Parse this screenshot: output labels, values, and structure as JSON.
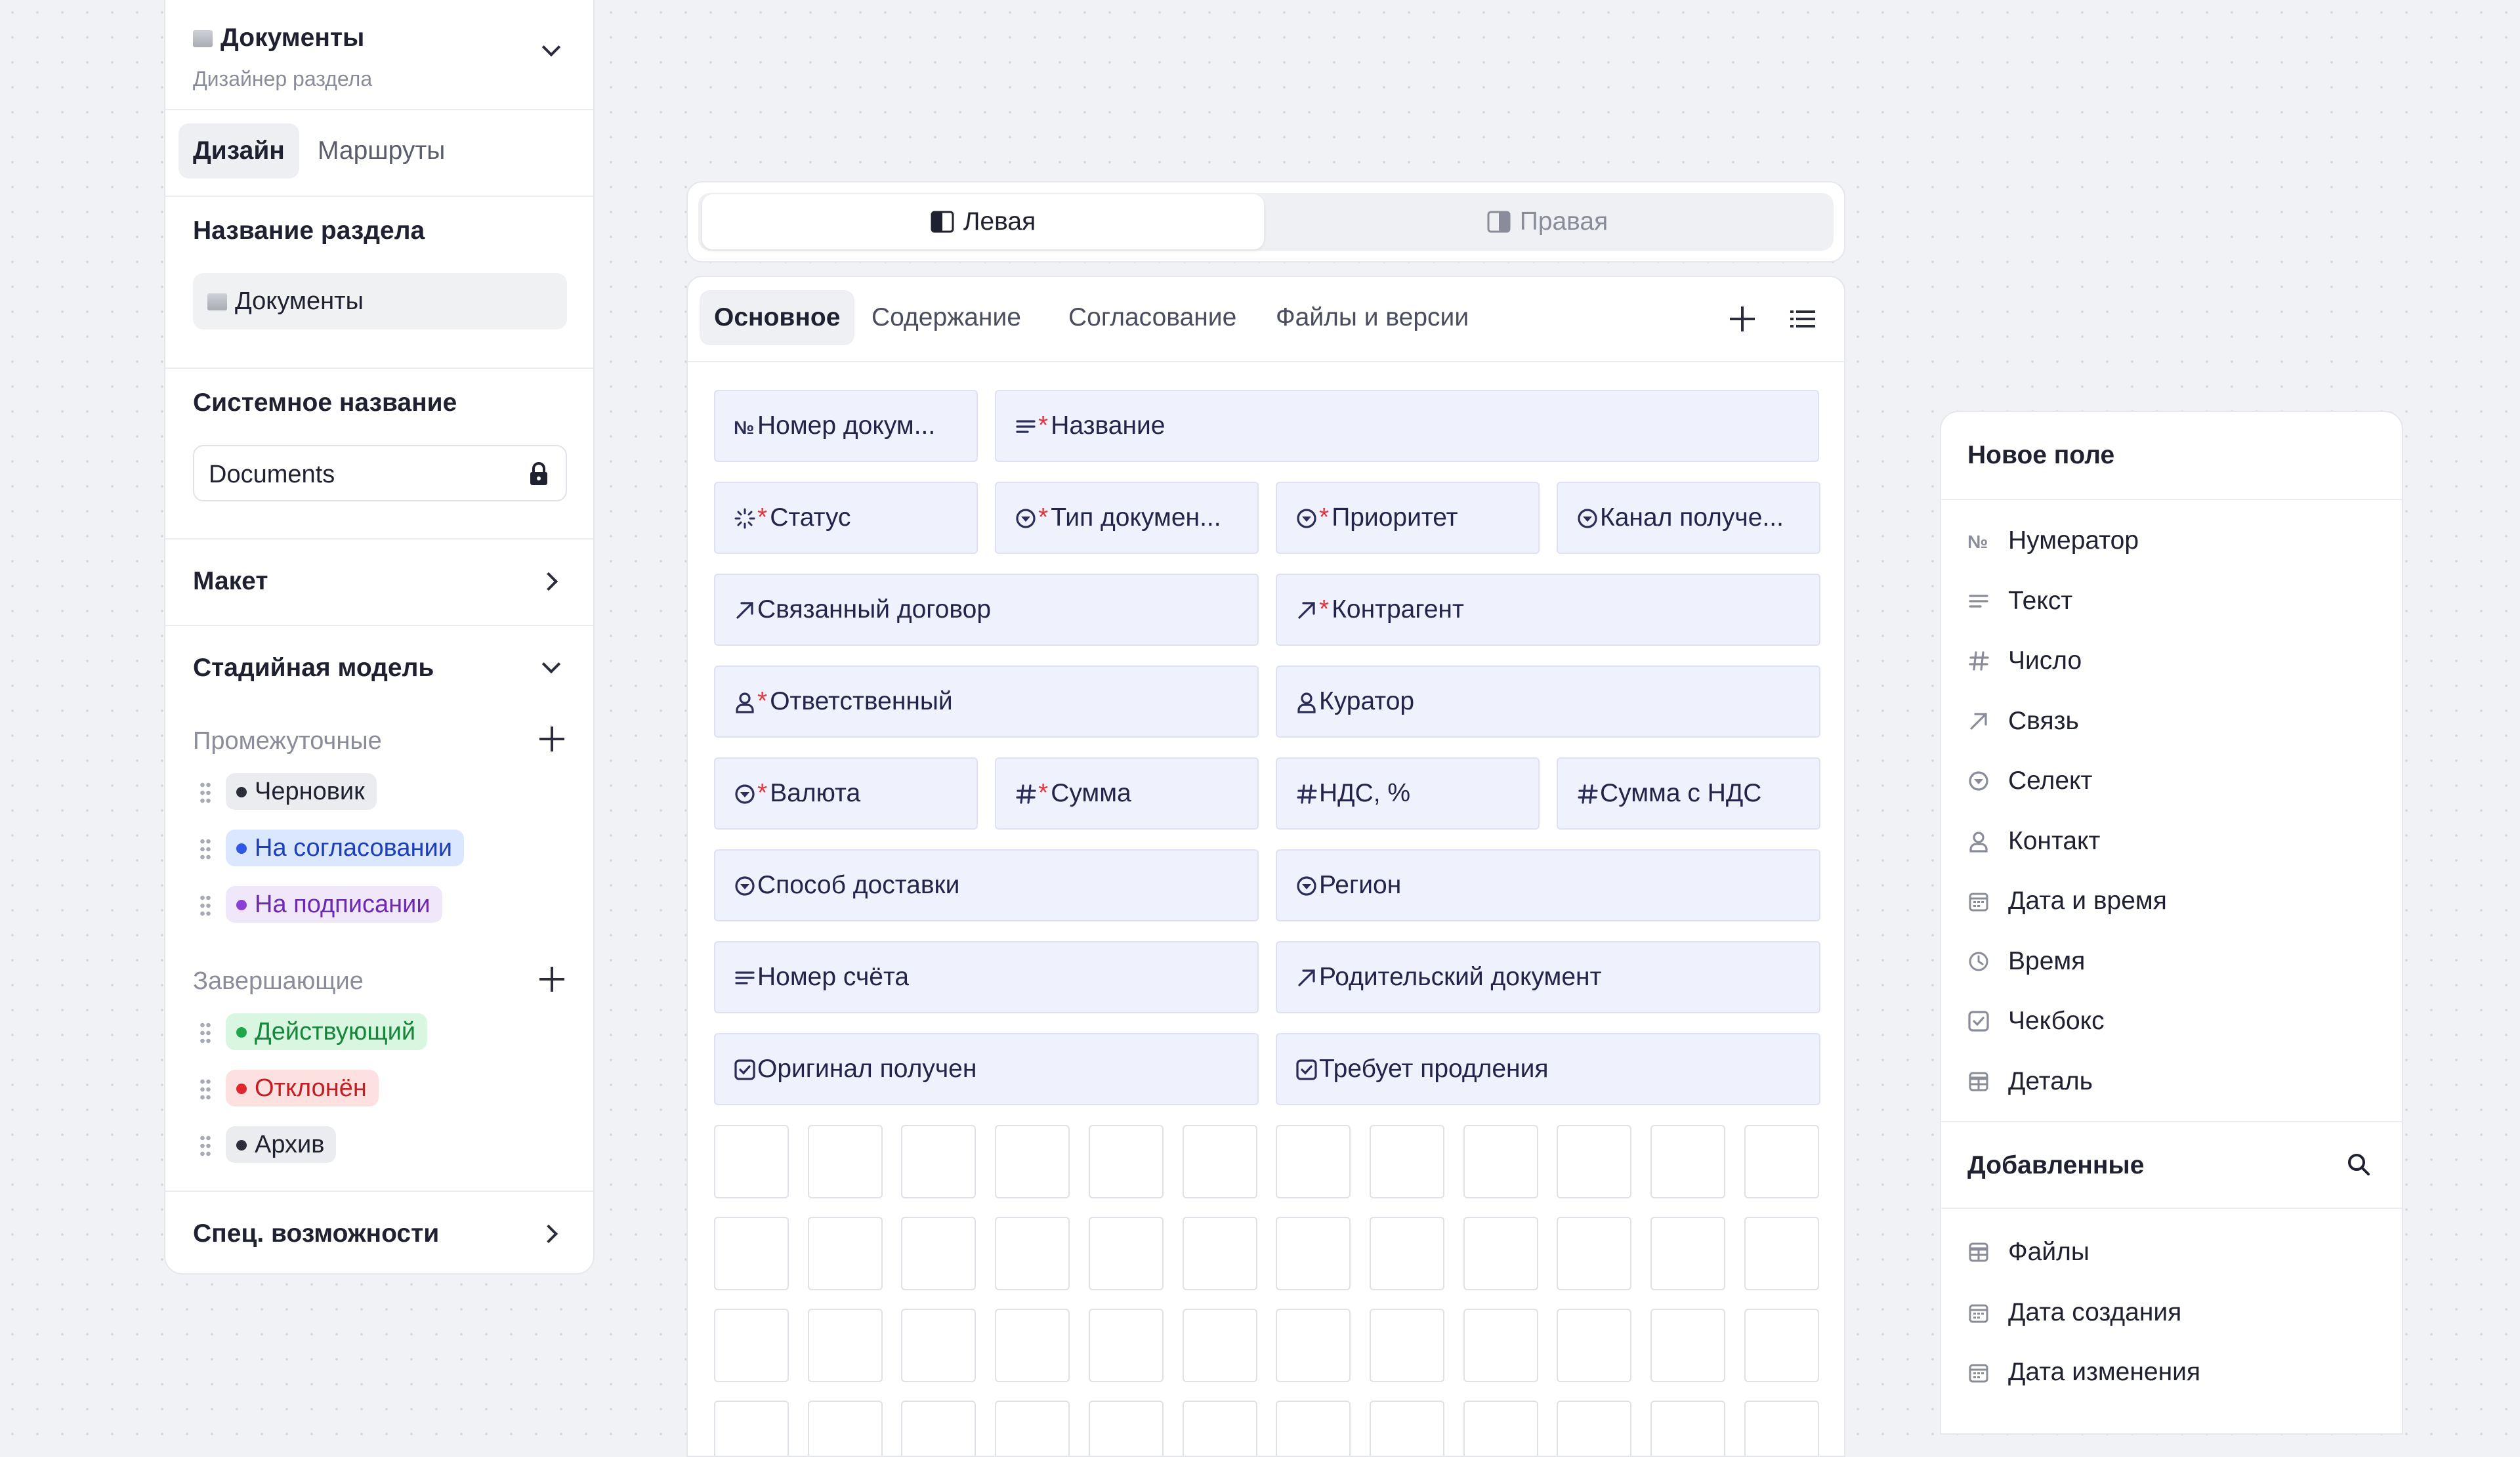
{
  "sidebar": {
    "section_title": "Документы",
    "section_subtitle": "Дизайнер раздела",
    "tabs": [
      {
        "label": "Дизайн",
        "active": true
      },
      {
        "label": "Маршруты",
        "active": false
      }
    ],
    "name_label": "Название раздела",
    "name_value": "Документы",
    "system_label": "Системное название",
    "system_value": "Documents",
    "layout_label": "Макет",
    "stage_label": "Стадийная модель",
    "intermediate_label": "Промежуточные",
    "intermediate": [
      {
        "label": "Черновик",
        "bg": "#ebecef",
        "dot": "#2c2e3a",
        "color": "#1f2130"
      },
      {
        "label": "На согласовании",
        "bg": "#dbe6ff",
        "dot": "#2e58e6",
        "color": "#1d3fb8"
      },
      {
        "label": "На подписании",
        "bg": "#f1e7fb",
        "dot": "#8b3fd6",
        "color": "#6b2ab0"
      }
    ],
    "final_label": "Завершающие",
    "final": [
      {
        "label": "Действующий",
        "bg": "#d9f6e1",
        "dot": "#1fa64a",
        "color": "#17853b"
      },
      {
        "label": "Отклонён",
        "bg": "#fde0e0",
        "dot": "#e0262b",
        "color": "#c11f23"
      },
      {
        "label": "Архив",
        "bg": "#ebecef",
        "dot": "#2c2e3a",
        "color": "#1f2130"
      }
    ],
    "special_label": "Спец. возможности"
  },
  "switcher": {
    "left": "Левая",
    "right": "Правая",
    "active": "left"
  },
  "canvas": {
    "tabs": [
      "Основное",
      "Содержание",
      "Согласование",
      "Файлы и версии"
    ],
    "active_tab": "Основное",
    "fields": [
      {
        "label": "Номер докум...",
        "icon": "numero-icon",
        "required": false
      },
      {
        "label": "Название",
        "icon": "text-icon",
        "required": true
      },
      {
        "label": "Статус",
        "icon": "status-icon",
        "required": true
      },
      {
        "label": "Тип докумен...",
        "icon": "select-icon",
        "required": true
      },
      {
        "label": "Приоритет",
        "icon": "select-icon",
        "required": true
      },
      {
        "label": "Канал получе...",
        "icon": "select-icon",
        "required": false
      },
      {
        "label": "Связанный договор",
        "icon": "link-icon",
        "required": false
      },
      {
        "label": "Контрагент",
        "icon": "link-icon",
        "required": true
      },
      {
        "label": "Ответственный",
        "icon": "user-icon",
        "required": true
      },
      {
        "label": "Куратор",
        "icon": "user-icon",
        "required": false
      },
      {
        "label": "Валюта",
        "icon": "select-icon",
        "required": true
      },
      {
        "label": "Сумма",
        "icon": "hash-icon",
        "required": true
      },
      {
        "label": "НДС, %",
        "icon": "hash-icon",
        "required": false
      },
      {
        "label": "Сумма с НДС",
        "icon": "hash-icon",
        "required": false
      },
      {
        "label": "Способ доставки",
        "icon": "select-icon",
        "required": false
      },
      {
        "label": "Регион",
        "icon": "select-icon",
        "required": false
      },
      {
        "label": "Номер счёта",
        "icon": "text-icon",
        "required": false
      },
      {
        "label": "Родительский документ",
        "icon": "link-icon",
        "required": false
      },
      {
        "label": "Оригинал получен",
        "icon": "checkbox-icon",
        "required": false
      },
      {
        "label": "Требует продления",
        "icon": "checkbox-icon",
        "required": false
      }
    ]
  },
  "new_field": {
    "title": "Новое поле",
    "items": [
      {
        "label": "Нумератор",
        "icon": "numero-icon"
      },
      {
        "label": "Текст",
        "icon": "text-icon"
      },
      {
        "label": "Число",
        "icon": "hash-icon"
      },
      {
        "label": "Связь",
        "icon": "link-icon"
      },
      {
        "label": "Селект",
        "icon": "select-icon"
      },
      {
        "label": "Контакт",
        "icon": "user-icon"
      },
      {
        "label": "Дата и время",
        "icon": "calendar-icon"
      },
      {
        "label": "Время",
        "icon": "clock-icon"
      },
      {
        "label": "Чекбокс",
        "icon": "checkbox-icon"
      },
      {
        "label": "Деталь",
        "icon": "table-icon"
      }
    ],
    "added_title": "Добавленные",
    "added": [
      {
        "label": "Файлы",
        "icon": "table-icon"
      },
      {
        "label": "Дата создания",
        "icon": "calendar-icon"
      },
      {
        "label": "Дата изменения",
        "icon": "calendar-icon"
      }
    ]
  },
  "colors": {
    "accent": "#2e58e6",
    "field_bg": "#eff1fc",
    "required": "#e0383e"
  }
}
